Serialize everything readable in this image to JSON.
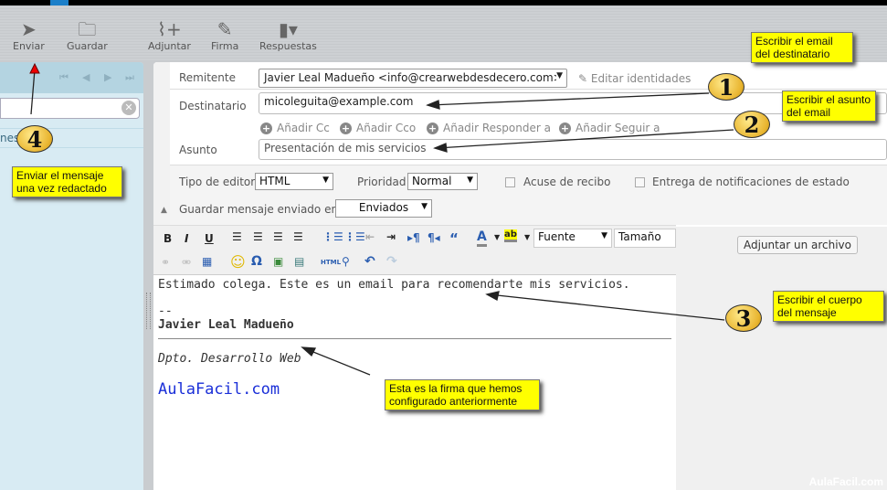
{
  "toolbar": {
    "send": "Enviar",
    "save": "Guardar",
    "attach": "Adjuntar",
    "signature": "Firma",
    "responses": "Respuestas"
  },
  "left_pane": {
    "folder_item": "nes  nales"
  },
  "compose": {
    "from_label": "Remitente",
    "from_value": "Javier Leal Madueño <info@crearwebdesdecero.com>",
    "edit_identities": "Editar identidades",
    "to_label": "Destinatario",
    "to_value": "micoleguita@example.com",
    "add_cc": "Añadir Cc",
    "add_bcc": "Añadir Cco",
    "add_reply_to": "Añadir Responder a",
    "add_followup_to": "Añadir Seguir a",
    "subject_label": "Asunto",
    "subject_value": "Presentación de mis servicios",
    "editor_type_label": "Tipo de editor",
    "editor_type_value": "HTML",
    "priority_label": "Prioridad",
    "priority_value": "Normal",
    "receipt_label": "Acuse de recibo",
    "dsn_label": "Entrega de notificaciones de estado",
    "save_sent_label": "Guardar mensaje enviado en",
    "save_sent_value": "Enviados"
  },
  "editor": {
    "font_placeholder": "Fuente",
    "size_placeholder": "Tamaño",
    "html_label": "HTML"
  },
  "body": {
    "line1": "Estimado colega. Este es un email para recomendarte mis servicios.",
    "sig_sep": "--",
    "sig_name": "Javier Leal Madueño",
    "sig_dept": "Dpto. Desarrollo Web",
    "sig_link": "AulaFacil.com"
  },
  "attach_file": "Adjuntar un archivo",
  "annotations": {
    "n1": "1",
    "n2": "2",
    "n3": "3",
    "n4": "4",
    "note_to": "Escribir el email del destinatario",
    "note_subject": "Escribir el asunto del email",
    "note_body": "Escribir el cuerpo del mensaje",
    "note_send": "Enviar el mensaje una vez redactado",
    "note_signature": "Esta es la firma que hemos configurado anteriormente"
  },
  "watermark": "AulaFacil.com"
}
